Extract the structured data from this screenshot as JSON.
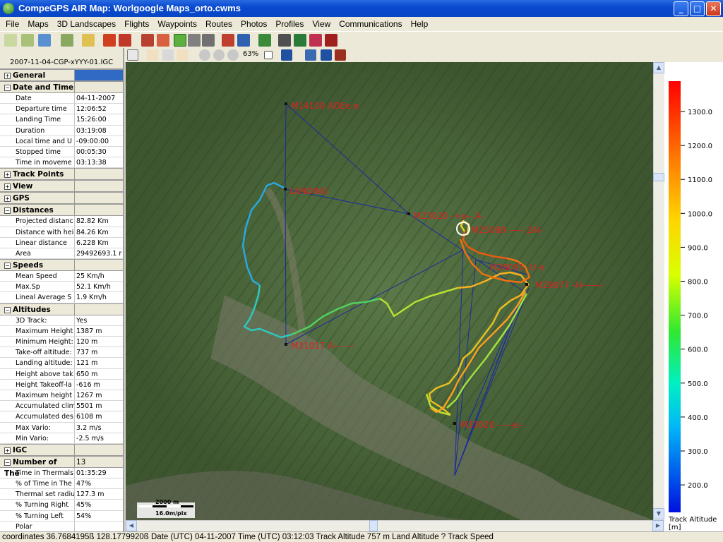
{
  "window": {
    "title": "CompeGPS AIR Map: Worlgoogle Maps_orto.cwms",
    "minimize": "_",
    "maximize": "□",
    "close": "✕"
  },
  "menu": [
    "File",
    "Maps",
    "3D Landscapes",
    "Flights",
    "Waypoints",
    "Routes",
    "Photos",
    "Profiles",
    "View",
    "Communications",
    "Help"
  ],
  "toolbar2": {
    "zoom_level": "63%"
  },
  "panel": {
    "file": "2007-11-04-CGP-xYYY-01.IGC",
    "sections": [
      {
        "title": "General",
        "rows": []
      },
      {
        "title": "Date and Time",
        "expanded": true,
        "rows": [
          [
            "Date",
            "04-11-2007"
          ],
          [
            "Departure time",
            "12:06:52"
          ],
          [
            "Landing Time",
            "15:26:00"
          ],
          [
            "Duration",
            "03:19:08"
          ],
          [
            "Local time and U",
            "-09:00:00"
          ],
          [
            "Stopped time",
            "00:05:30"
          ],
          [
            "Time in moveme",
            "03:13:38"
          ]
        ]
      },
      {
        "title": "Track Points",
        "rows": []
      },
      {
        "title": "View",
        "rows": []
      },
      {
        "title": "GPS",
        "rows": []
      },
      {
        "title": "Distances",
        "expanded": true,
        "rows": [
          [
            "Projected distanc",
            "82.82 Km"
          ],
          [
            "Distance with hei",
            "84.26 Km"
          ],
          [
            "Linear distance",
            "6.228 Km"
          ],
          [
            "Area",
            "29492693.1 r"
          ]
        ]
      },
      {
        "title": "Speeds",
        "expanded": true,
        "rows": [
          [
            "Mean Speed",
            "25 Km/h"
          ],
          [
            "Max.Sp",
            "52.1 Km/h"
          ],
          [
            "Lineal Average S",
            "1.9 Km/h"
          ]
        ]
      },
      {
        "title": "Altitudes",
        "expanded": true,
        "rows": [
          [
            "3D Track:",
            "Yes"
          ],
          [
            "Maximum Height",
            "1387 m"
          ],
          [
            "Minimum Height:",
            "120 m"
          ],
          [
            "Take-off altitude:",
            "737 m"
          ],
          [
            "Landing altitude:",
            "121 m"
          ],
          [
            "Height above tak",
            "650 m"
          ],
          [
            "Height Takeoff-la",
            "-616 m"
          ],
          [
            "Maximum height a",
            "1267 m"
          ],
          [
            "Accumulated clim",
            "5501 m"
          ],
          [
            "Accumulated des",
            "6108 m"
          ],
          [
            "Max Vario:",
            "3.2 m/s"
          ],
          [
            "Min Vario:",
            "-2.5 m/s"
          ]
        ]
      },
      {
        "title": "IGC",
        "rows": []
      },
      {
        "title": "Number of The",
        "value": "13",
        "expanded": true,
        "rows": [
          [
            "Time in Thermals",
            "01:35:29"
          ],
          [
            "% of Time in The",
            "47%"
          ],
          [
            "Thermal set radiu",
            "127.3 m"
          ],
          [
            "% Turning Right",
            "45%"
          ],
          [
            "% Turning Left",
            "54%"
          ],
          [
            "Polar",
            ""
          ]
        ]
      }
    ]
  },
  "map": {
    "waypoints": [
      {
        "label": "M14100 AOEe-e"
      },
      {
        "label": "LANDING"
      },
      {
        "label": "M23020 -+a-- A-"
      },
      {
        "label": "M25088 ----- 2AI-"
      },
      {
        "label": "M28091 -U-e"
      },
      {
        "label": "M29077 -l+------"
      },
      {
        "label": "M31017 A--- ---"
      },
      {
        "label": "M33020 -----e--"
      }
    ],
    "scale_label": "2000 m",
    "resolution_label": "16.0m/pix"
  },
  "legend": {
    "title": "Track Altitude",
    "unit": "[m]",
    "ticks": [
      "1300.0",
      "1200.0",
      "1100.0",
      "1000.0",
      "900.0",
      "800.0",
      "700.0",
      "600.0",
      "500.0",
      "400.0",
      "300.0",
      "200.0"
    ]
  },
  "status": "coordinates 36.7684195ß 128.1779920ß Date (UTC) 04-11-2007 Time (UTC) 03:12:03 Track Altitude 757 m Land Altitude ? Track Speed"
}
